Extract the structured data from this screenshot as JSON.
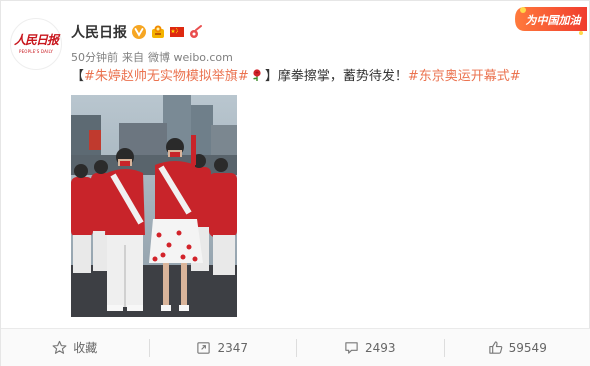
{
  "post": {
    "account_name": "人民日报",
    "avatar_text": "人民日报",
    "avatar_subtext": "PEOPLE'S DAILY",
    "time": "50分钟前",
    "source_prefix": "来自",
    "source": "微博 weibo.com",
    "content": {
      "bracket_open": "【",
      "tag1": "#朱婷赵帅无实物模拟举旗#",
      "bracket_close": "】",
      "text": "摩拳擦掌，蓄势待发！",
      "tag2": "#东京奥运开幕式#"
    },
    "banner_text": "为中国加油"
  },
  "actions": {
    "favorite_label": "收藏",
    "repost_count": "2347",
    "comment_count": "2493",
    "like_count": "59549"
  },
  "colors": {
    "link": "#eb7350",
    "brand_red": "#c8161d",
    "verified": "#f6a623"
  },
  "icons": [
    "verified-icon",
    "gold-badge-icon",
    "china-flag-icon",
    "rose-icon",
    "star-icon",
    "repost-icon",
    "comment-icon",
    "like-icon"
  ]
}
